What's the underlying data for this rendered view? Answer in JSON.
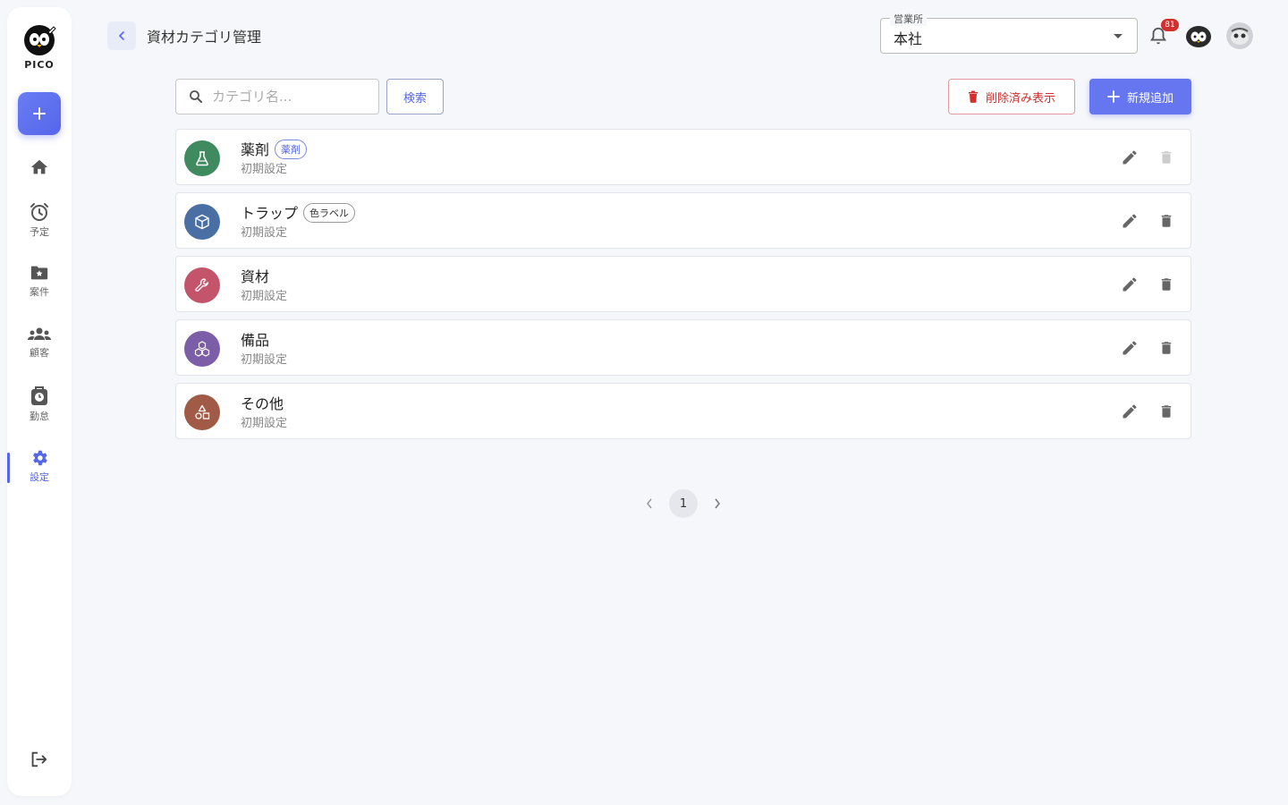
{
  "app": {
    "logo_text": "PICO"
  },
  "header": {
    "title": "資材カテゴリ管理",
    "office_legend": "営業所",
    "office_value": "本社",
    "notification_count": "81"
  },
  "sidebar": {
    "items": [
      {
        "label": ""
      },
      {
        "label": "予定"
      },
      {
        "label": "案件"
      },
      {
        "label": "顧客"
      },
      {
        "label": "勤怠"
      },
      {
        "label": "設定"
      }
    ]
  },
  "toolbar": {
    "search_placeholder": "カテゴリ名...",
    "search_button": "検索",
    "deleted_button": "削除済み表示",
    "new_button": "新規追加"
  },
  "categories": [
    {
      "name": "薬剤",
      "tag": "薬剤",
      "sub": "初期設定",
      "color": "#3f8a5e",
      "icon": "flask-icon",
      "delete_disabled": true
    },
    {
      "name": "トラップ",
      "tag": "色ラベル",
      "sub": "初期設定",
      "color": "#4a6fa5",
      "icon": "box-icon",
      "delete_disabled": false
    },
    {
      "name": "資材",
      "tag": "",
      "sub": "初期設定",
      "color": "#c4546a",
      "icon": "wrench-icon",
      "delete_disabled": false
    },
    {
      "name": "備品",
      "tag": "",
      "sub": "初期設定",
      "color": "#7b5ea7",
      "icon": "cubes-icon",
      "delete_disabled": false
    },
    {
      "name": "その他",
      "tag": "",
      "sub": "初期設定",
      "color": "#a05a45",
      "icon": "shapes-icon",
      "delete_disabled": false
    }
  ],
  "pagination": {
    "current": "1"
  }
}
